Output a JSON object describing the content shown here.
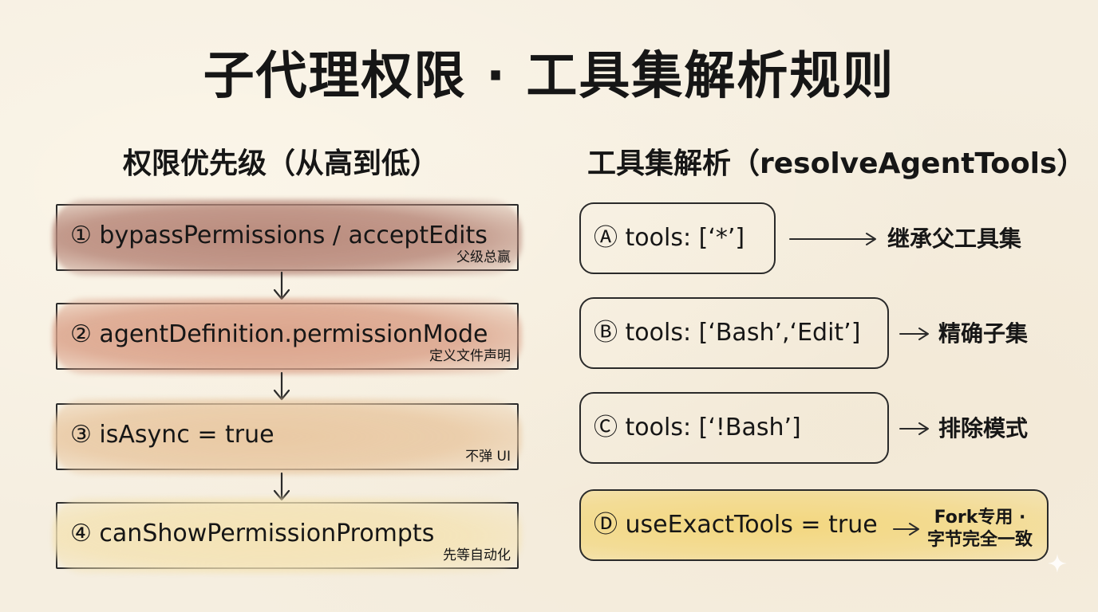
{
  "title": "子代理权限 · 工具集解析规则",
  "permission": {
    "heading": "权限优先级（从高到低）",
    "items": [
      {
        "label": "① bypassPermissions / acceptEdits",
        "note": "父级总赢",
        "color": "#b98a7c"
      },
      {
        "label": "② agentDefinition.permissionMode",
        "note": "定义文件声明",
        "color": "#dba48c"
      },
      {
        "label": "③ isAsync = true",
        "note": "不弹 UI",
        "color": "#e9c9a4"
      },
      {
        "label": "④ canShowPermissionPrompts",
        "note": "先等自动化",
        "color": "#f4e3b6"
      }
    ]
  },
  "tools": {
    "heading": "工具集解析（resolveAgentTools）",
    "items": [
      {
        "label": "Ⓐ tools: [‘*’]",
        "result": "继承父工具集"
      },
      {
        "label": "Ⓑ tools: [‘Bash’,‘Edit’]",
        "result": "精确子集"
      },
      {
        "label": "Ⓒ tools: [‘!Bash’]",
        "result": "排除模式"
      },
      {
        "label": "Ⓓ useExactTools = true",
        "result_line1": "Fork专用 ·",
        "result_line2": "字节完全一致",
        "color": "#f3d77e"
      }
    ]
  }
}
